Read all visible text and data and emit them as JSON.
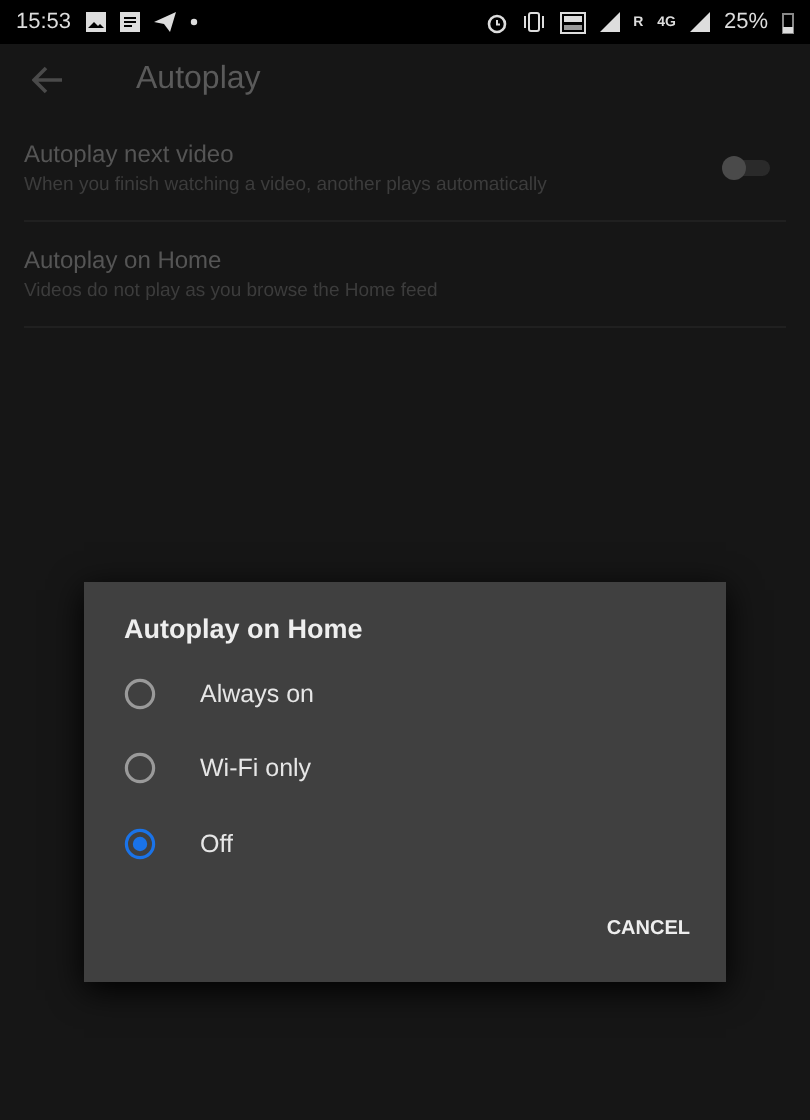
{
  "status_bar": {
    "time": "15:53",
    "roaming": "R",
    "network": "4G",
    "battery": "25%"
  },
  "app_bar": {
    "title": "Autoplay"
  },
  "settings": [
    {
      "kind": "toggle",
      "title": "Autoplay next video",
      "subtitle": "When you finish watching a video, another plays automatically",
      "on": false
    },
    {
      "kind": "choice",
      "title": "Autoplay on Home",
      "subtitle": "Videos do not play as you browse the Home feed"
    }
  ],
  "dialog": {
    "title": "Autoplay on Home",
    "options": [
      {
        "label": "Always on",
        "selected": false
      },
      {
        "label": "Wi-Fi only",
        "selected": false
      },
      {
        "label": "Off",
        "selected": true
      }
    ],
    "buttons": [
      "CANCEL"
    ]
  }
}
